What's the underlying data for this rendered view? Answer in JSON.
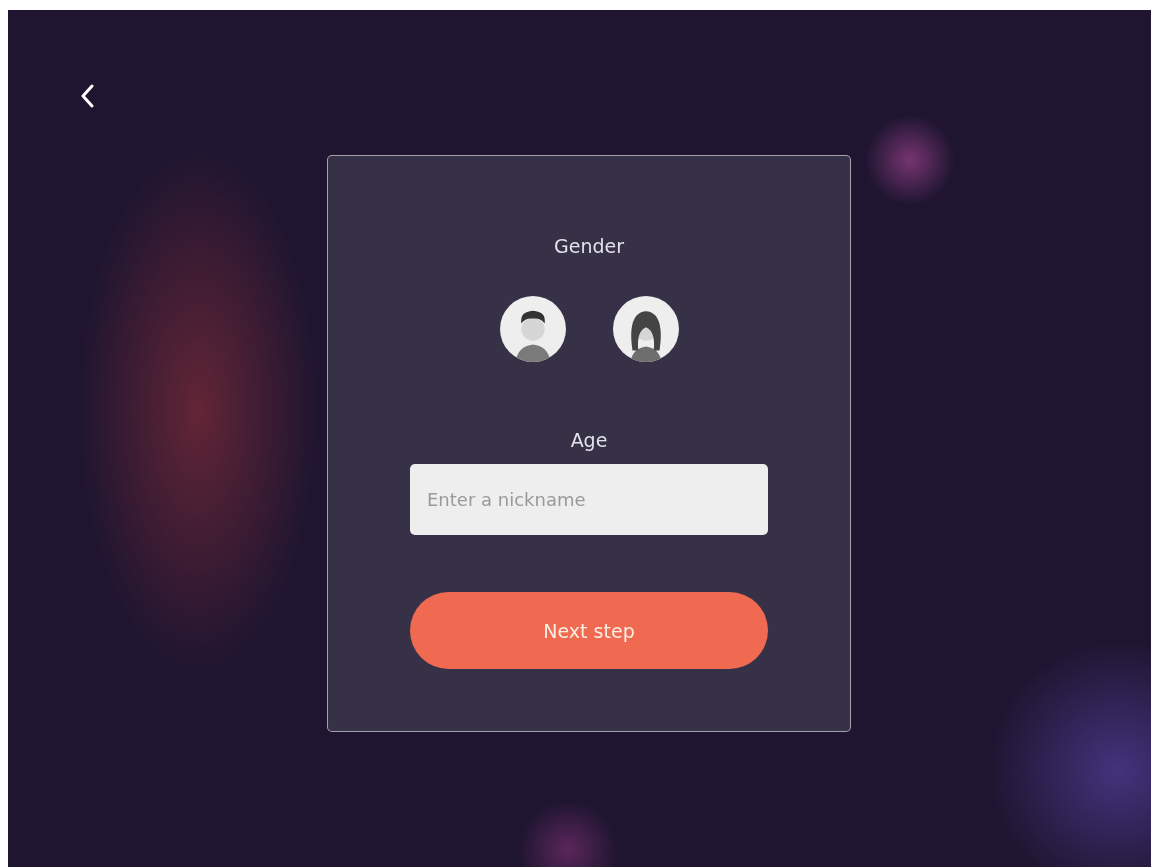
{
  "form": {
    "gender_label": "Gender",
    "gender_options": [
      {
        "kind": "male"
      },
      {
        "kind": "female"
      }
    ],
    "age_label": "Age",
    "age_field": {
      "placeholder": "Enter a nickname"
    },
    "next_button": {
      "label": "Next step"
    }
  }
}
